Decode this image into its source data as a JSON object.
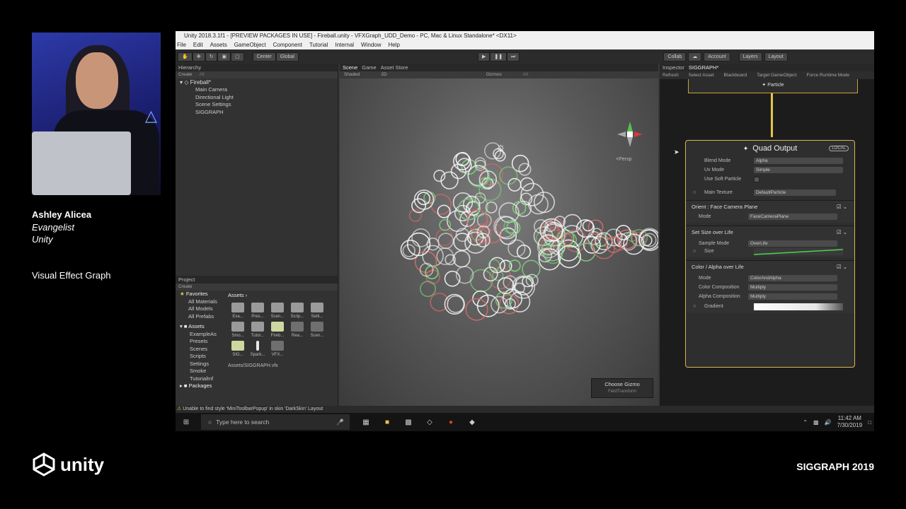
{
  "speaker": {
    "name": "Ashley Alicea",
    "role": "Evangelist",
    "company": "Unity"
  },
  "talk": {
    "title": "Visual Effect Graph"
  },
  "branding": {
    "logo_text": "unity",
    "conference": "SIGGRAPH 2019"
  },
  "window": {
    "title": "Unity 2018.3.1f1 - [PREVIEW PACKAGES IN USE] - Fireball.unity - VFXGraph_UDD_Demo - PC, Mac & Linux Standalone* <DX11>",
    "menu": [
      "File",
      "Edit",
      "Assets",
      "GameObject",
      "Component",
      "Tutorial",
      "Internal",
      "Window",
      "Help"
    ]
  },
  "toolbar": {
    "center": "Center",
    "global": "Global",
    "collab": "Collab",
    "account": "Account",
    "layers": "Layers",
    "layout": "Layout"
  },
  "hierarchy": {
    "tab": "Hierarchy",
    "create": "Create",
    "search": "All",
    "root": "Fireball*",
    "items": [
      "Main Camera",
      "Directional Light",
      "Scene Settings",
      "SIGGRAPH"
    ]
  },
  "project": {
    "tab": "Project",
    "create": "Create",
    "favorites_label": "Favorites",
    "favorites": [
      "All Materials",
      "All Models",
      "All Prefabs"
    ],
    "assets_label": "Assets",
    "asset_folders": [
      "ExampleAs",
      "Presets",
      "Scenes",
      "Scripts",
      "Settings",
      "Smoke",
      "TutorialInf"
    ],
    "packages_label": "Packages",
    "breadcrumb": "Assets",
    "grid": [
      "Exa...",
      "Pres...",
      "Scen...",
      "Scrip...",
      "Setti...",
      "Smo...",
      "Tutor...",
      "Fireb...",
      "Rea...",
      "Scen...",
      "SIG...",
      "Spark...",
      "VFX..."
    ],
    "path": "Assets/SIGGRAPH.vfx"
  },
  "scene": {
    "tabs": [
      "Scene",
      "Game",
      "Asset Store"
    ],
    "shading": "Shaded",
    "mode_2d": "2D",
    "gizmos": "Gizmos",
    "search": "All",
    "persp": "<Persp",
    "choose_gizmo": "Choose Gizmo",
    "gizmo_value": "FieldTransform"
  },
  "inspector": {
    "tabs": [
      "Inspector",
      "SIGGRAPH*"
    ],
    "actions": [
      "Refresh",
      "Select Asset",
      "Blackboard",
      "Target GameObject",
      "Force Runtime Mode"
    ],
    "particle_node": "Particle",
    "quad_output": {
      "title": "Quad Output",
      "badge": "LOCAL",
      "fields": [
        {
          "label": "Blend Mode",
          "value": "Alpha"
        },
        {
          "label": "Uv Mode",
          "value": "Simple"
        },
        {
          "label": "Use Soft Particle",
          "value": ""
        }
      ],
      "main_texture_label": "Main Texture",
      "main_texture_value": "DefaultParticle",
      "blocks": [
        {
          "title": "Orient : Face Camera Plane",
          "rows": [
            {
              "label": "Mode",
              "value": "FaceCameraPlane"
            }
          ]
        },
        {
          "title": "Set Size over Life",
          "rows": [
            {
              "label": "Sample Mode",
              "value": "OverLife"
            },
            {
              "label": "Size",
              "value": ""
            }
          ]
        },
        {
          "title": "Color / Alpha over Life",
          "rows": [
            {
              "label": "Mode",
              "value": "ColorAndAlpha"
            },
            {
              "label": "Color Composition",
              "value": "Multiply"
            },
            {
              "label": "Alpha Composition",
              "value": "Multiply"
            },
            {
              "label": "Gradient",
              "value": ""
            }
          ]
        }
      ]
    }
  },
  "console": {
    "message": "Unable to find style 'MiniToolbarPopup' in skin 'DarkSkin' Layout"
  },
  "taskbar": {
    "search_placeholder": "Type here to search",
    "time": "11:42 AM",
    "date": "7/30/2019"
  }
}
